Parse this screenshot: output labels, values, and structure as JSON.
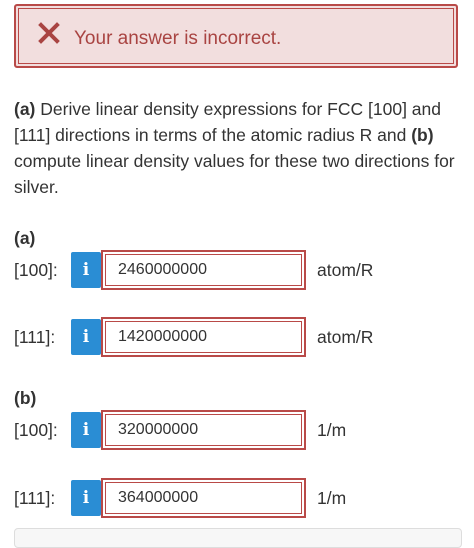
{
  "alert": {
    "icon": "x-mark-icon",
    "message": "Your answer is incorrect.",
    "color": "#a94442"
  },
  "question": {
    "part_a_marker": "(a)",
    "text_1": " Derive linear density expressions for FCC [100] and [111] directions in terms of the atomic radius R and ",
    "part_b_marker": "(b)",
    "text_2": " compute linear density values for these two directions for silver."
  },
  "part_a": {
    "label": "(a)",
    "rows": [
      {
        "direction": "[100]:",
        "info_icon": "i",
        "value": "2460000000",
        "unit": "atom/R"
      },
      {
        "direction": "[111]:",
        "info_icon": "i",
        "value": "1420000000",
        "unit": "atom/R"
      }
    ]
  },
  "part_b": {
    "label": "(b)",
    "rows": [
      {
        "direction": "[100]:",
        "info_icon": "i",
        "value": "320000000",
        "unit": "1/m"
      },
      {
        "direction": "[111]:",
        "info_icon": "i",
        "value": "364000000",
        "unit": "1/m"
      }
    ]
  },
  "colors": {
    "error": "#b94a48",
    "error_bg": "#f2dede",
    "info_button": "#2a8dd4"
  }
}
